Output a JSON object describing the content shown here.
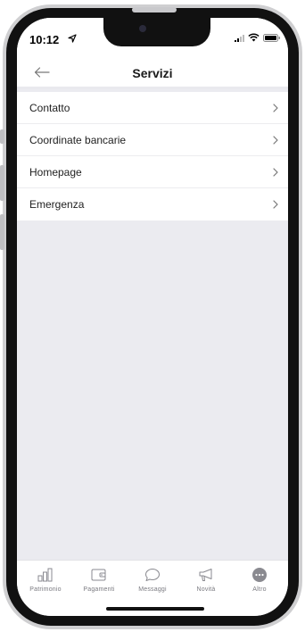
{
  "status_bar": {
    "time": "10:12"
  },
  "header": {
    "title": "Servizi"
  },
  "list": {
    "items": [
      {
        "label": "Contatto"
      },
      {
        "label": "Coordinate bancarie"
      },
      {
        "label": "Homepage"
      },
      {
        "label": "Emergenza"
      }
    ]
  },
  "tab_bar": {
    "tabs": [
      {
        "label": "Patrimonio",
        "icon": "bar-chart-icon"
      },
      {
        "label": "Pagamenti",
        "icon": "wallet-icon"
      },
      {
        "label": "Messaggi",
        "icon": "chat-bubble-icon"
      },
      {
        "label": "Novità",
        "icon": "megaphone-icon"
      },
      {
        "label": "Altro",
        "icon": "more-icon",
        "selected": true
      }
    ]
  },
  "colors": {
    "background": "#ebebf0",
    "icon_gray": "#8a8a90",
    "text": "#222222"
  }
}
